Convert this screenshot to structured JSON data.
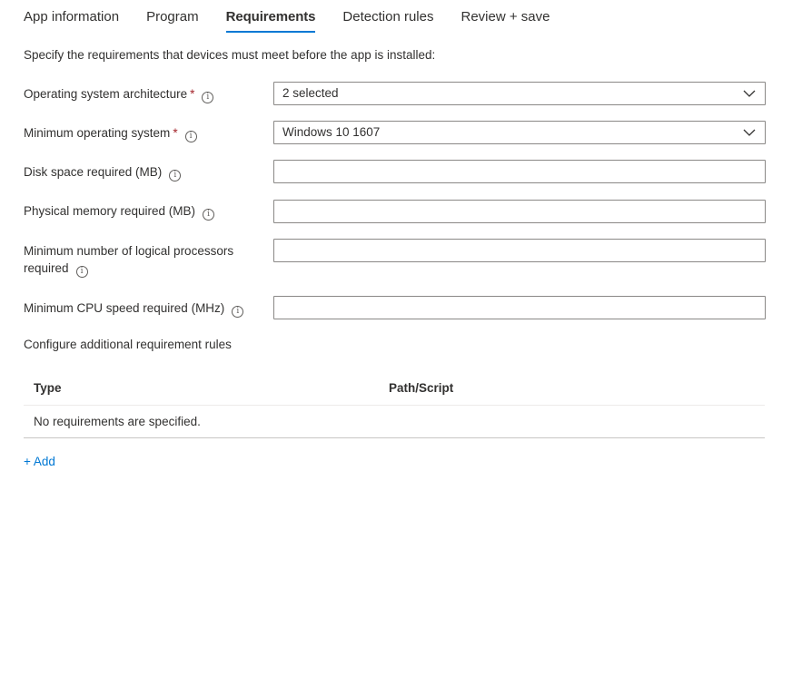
{
  "tabs": [
    {
      "label": "App information"
    },
    {
      "label": "Program"
    },
    {
      "label": "Requirements"
    },
    {
      "label": "Detection rules"
    },
    {
      "label": "Review + save"
    }
  ],
  "active_tab": "Requirements",
  "intro_text": "Specify the requirements that devices must meet before the app is installed:",
  "fields": {
    "os_architecture": {
      "label": "Operating system architecture",
      "required": "*",
      "value": "2 selected"
    },
    "min_os": {
      "label": "Minimum operating system",
      "required": "*",
      "value": "Windows 10 1607"
    },
    "disk_space": {
      "label": "Disk space required (MB)",
      "value": ""
    },
    "physical_memory": {
      "label": "Physical memory required (MB)",
      "value": ""
    },
    "logical_processors": {
      "label_line1": "Minimum number of logical processors",
      "label_line2": "required",
      "value": ""
    },
    "cpu_speed": {
      "label": "Minimum CPU speed required (MHz)",
      "value": ""
    }
  },
  "additional_rules": {
    "label": "Configure additional requirement rules",
    "columns": [
      "Type",
      "Path/Script"
    ],
    "empty_text": "No requirements are specified.",
    "add_label": "+ Add"
  },
  "icons": {
    "info": "info-icon",
    "dropdown": "chevron-down-icon"
  },
  "colors": {
    "accent": "#0078d4",
    "required": "#a4262c",
    "text": "#323130"
  }
}
